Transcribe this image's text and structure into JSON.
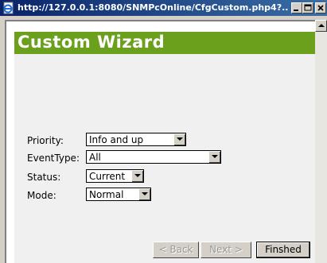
{
  "window": {
    "title": "http://127.0.0.1:8080/SNMPcOnline/CfgCustom.php4?...",
    "icon": "ie-page-icon"
  },
  "wizard": {
    "title": "Custom Wizard",
    "fields": [
      {
        "label": "Priority:",
        "value": "Info and up"
      },
      {
        "label": "EventType:",
        "value": "All"
      },
      {
        "label": "Status:",
        "value": "Current"
      },
      {
        "label": "Mode:",
        "value": "Normal"
      }
    ]
  },
  "buttons": {
    "back": "< Back",
    "next": "Next >",
    "finished": "Finshed"
  },
  "colors": {
    "header_bar": "#6aa01c",
    "titlebar": "#0a246a"
  }
}
